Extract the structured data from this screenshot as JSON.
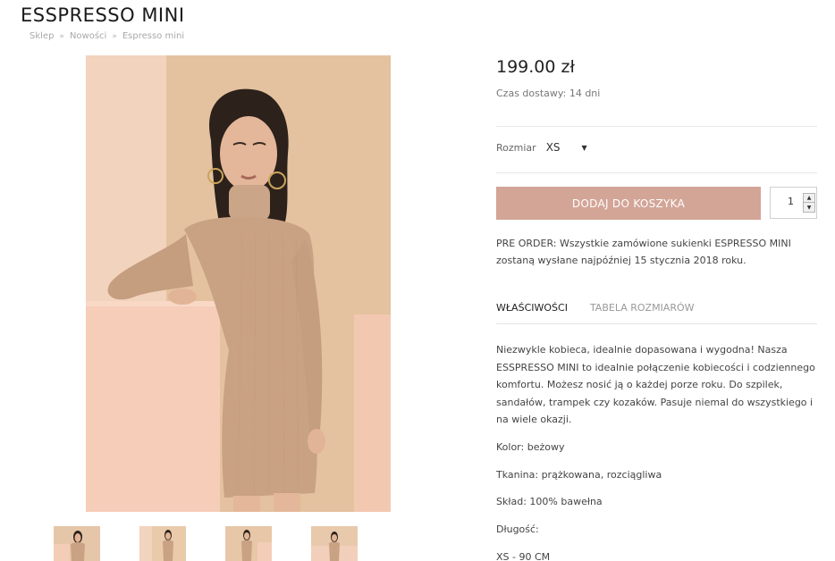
{
  "product": {
    "title": "ESSPRESSO MINI",
    "price": "199.00 zł",
    "delivery": "Czas dostawy: 14 dni"
  },
  "breadcrumb": {
    "items": [
      "Sklep",
      "Nowości",
      "Espresso mini"
    ],
    "separator": "»"
  },
  "size": {
    "label": "Rozmiar",
    "selected": "XS"
  },
  "cart": {
    "add_label": "DODAJ DO KOSZYKA",
    "quantity": "1"
  },
  "preorder_text": "PRE ORDER: Wszystkie zamówione sukienki ESPRESSO MINI zostaną wysłane najpóźniej 15 stycznia 2018 roku.",
  "tabs": [
    {
      "label": "WŁAŚCIWOŚCI",
      "active": true
    },
    {
      "label": "TABELA ROZMIARÓW",
      "active": false
    }
  ],
  "description": "Niezwykle kobieca, idealnie dopasowana i wygodna! Nasza ESSPRESSO MINI to idealnie połączenie kobiecości i codziennego komfortu. Możesz nosić ją o każdej porze roku. Do szpilek, sandałów, trampek czy kozaków. Pasuje niemal do wszystkiego i na wiele okazji.",
  "specs": {
    "color": "Kolor: beżowy",
    "fabric": "Tkanina: prążkowana, rozciągliwa",
    "composition": "Skład: 100% bawełna",
    "length_label": "Długość:",
    "length_value": "XS - 90 CM"
  },
  "colors": {
    "accent": "#d3a597",
    "dress": "#c9a183",
    "background": "#e7c9ab"
  }
}
